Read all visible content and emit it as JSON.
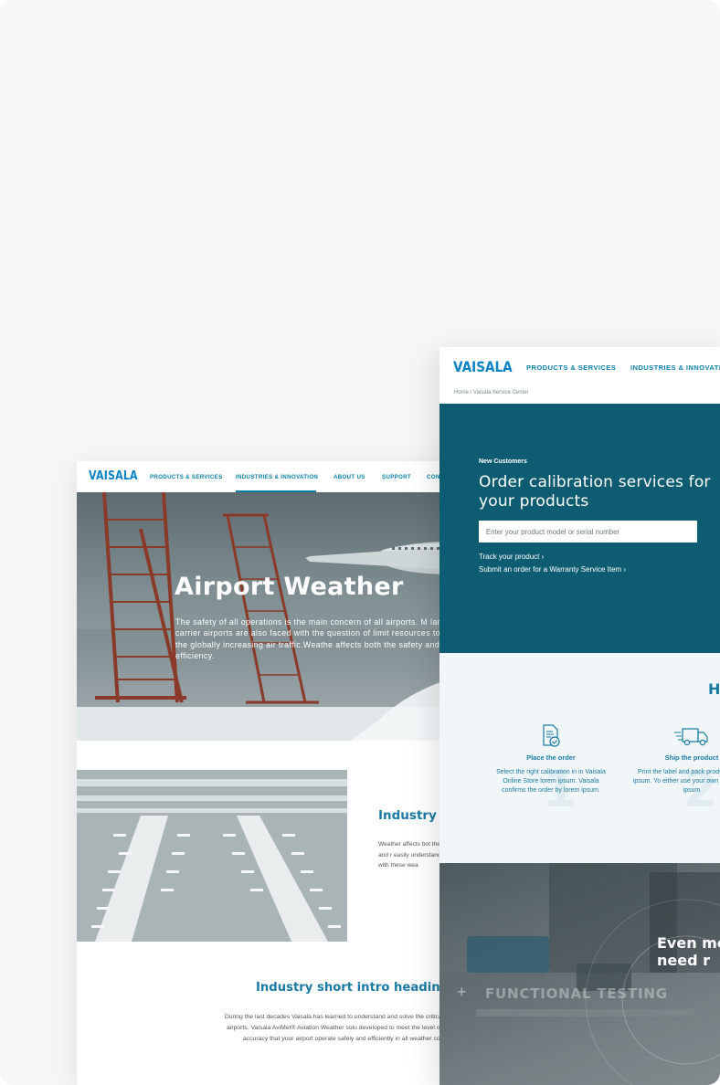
{
  "left_page": {
    "logo": "VAISALA",
    "nav": [
      "PRODUCTS & SERVICES",
      "INDUSTRIES & INNOVATION",
      "ABOUT US",
      "SUPPORT",
      "CON"
    ],
    "hero": {
      "title": "Airport Weather",
      "text": "The safety of all operations is the main concern of all airports. M large air carrier airports are also faced with the question of limit resources to cope with the globally increasing air traffic.Weathe affects both the safety and the efficiency."
    },
    "section": {
      "heading": "Industry H",
      "text": "Weather affects bot the most central fun time, accurate and r easily understandab for all different user cope with these wea"
    },
    "intro": {
      "heading": "Industry short intro heading",
      "text": "During the last decades Vaisala has learned to understand and solve the critical challenges at airports. Vaisala AviMet® Aviation Weather solu developed to meet the level of reliability and accuracy that your airport operate safely and efficiently in all weather conditions."
    }
  },
  "right_page": {
    "logo": "VAISALA",
    "nav": [
      "PRODUCTS & SERVICES",
      "INDUSTRIES & INNOVATIO"
    ],
    "breadcrumb": "Home / Vaisala Service Center",
    "hero": {
      "eyebrow": "New Customers",
      "title": "Order calibration services for your products",
      "search_placeholder": "Enter your product model or serial number",
      "links": [
        "Track your product ›",
        "Submit an order for a Warranty Service Item ›"
      ]
    },
    "how": {
      "heading": "H",
      "steps": [
        {
          "title": "Place the order",
          "text": "Select the right calibration in in Vaisala Online Store lorem ipsum. Vaisala confirms the order by lorem ipsum.",
          "number": "1",
          "icon": "document-check-icon"
        },
        {
          "title": "Ship the product",
          "text": "Print the label and pack product lorem ipsum. Yo either use your own cour lorem ipsum",
          "number": "2",
          "icon": "delivery-truck-icon"
        }
      ]
    },
    "lower": {
      "overlay_label": "FUNCTIONAL TESTING",
      "heading": "Even measure need r"
    }
  },
  "colors": {
    "brand_blue": "#0a82c4",
    "heading_blue": "#1b7aa3",
    "service_teal": "#0d5c72",
    "background": "#f7f7f8"
  }
}
